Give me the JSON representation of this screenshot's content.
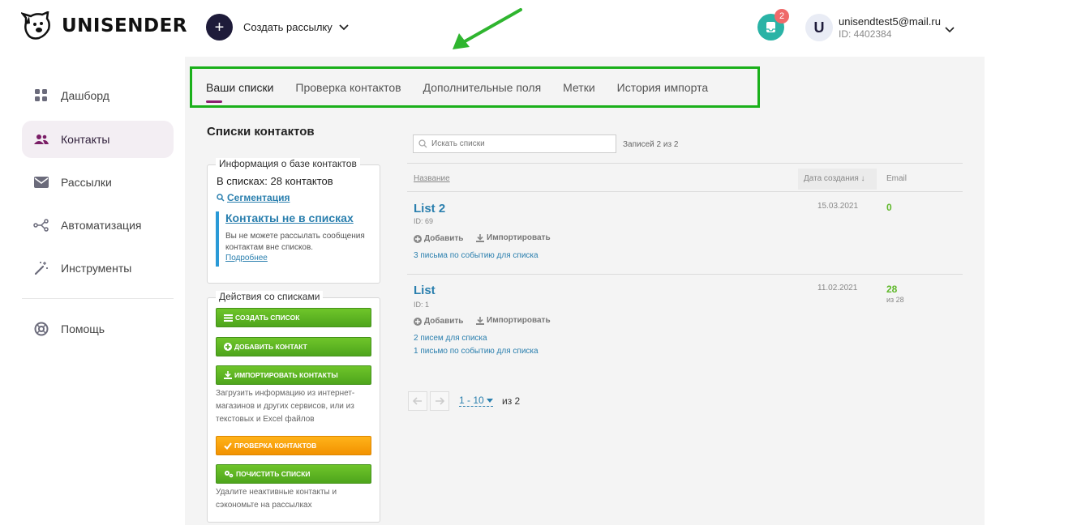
{
  "brand": {
    "name": "UNISENDER"
  },
  "header": {
    "create_label": "Создать рассылку",
    "notifications_count": "2",
    "user_initial": "U",
    "user_email": "unisendtest5@mail.ru",
    "user_id": "ID: 4402384"
  },
  "sidebar": {
    "items": [
      {
        "label": "Дашборд",
        "icon": "dashboard-icon"
      },
      {
        "label": "Контакты",
        "icon": "contacts-icon",
        "active": true
      },
      {
        "label": "Рассылки",
        "icon": "mail-icon"
      },
      {
        "label": "Автоматизация",
        "icon": "automation-icon"
      },
      {
        "label": "Инструменты",
        "icon": "magic-wand-icon"
      },
      {
        "label": "Помощь",
        "icon": "help-icon"
      }
    ]
  },
  "tabs": [
    {
      "label": "Ваши списки",
      "active": true
    },
    {
      "label": "Проверка контактов"
    },
    {
      "label": "Дополнительные поля"
    },
    {
      "label": "Метки"
    },
    {
      "label": "История импорта"
    }
  ],
  "page_title": "Списки контактов",
  "info_card": {
    "legend": "Информация о базе контактов",
    "count_text": "В списках: 28 контактов",
    "segmentation": "Сегментация",
    "not_in_lists_title": "Контакты не в списках",
    "not_in_lists_text": "Вы не можете рассылать сообщения контактам вне списков.",
    "more": "Подробнее"
  },
  "actions_card": {
    "legend": "Действия со списками",
    "create_list": "Создать список",
    "add_contact": "Добавить контакт",
    "import_contacts": "Импортировать контакты",
    "import_note": "Загрузить информацию из интернет-магазинов и других сервисов, или из текстовых и Excel файлов",
    "check_contacts": "Проверка контактов",
    "clean_lists": "Почистить списки",
    "clean_note": "Удалите неактивные контакты и сэкономьте на рассылках"
  },
  "search": {
    "placeholder": "Искать списки"
  },
  "records": "Записей 2 из 2",
  "table": {
    "col_name": "Название",
    "col_date": "Дата создания ↓",
    "col_email": "Email",
    "add_label": "Добавить",
    "import_label": "Импортировать",
    "rows": [
      {
        "name": "List 2",
        "id": "ID: 69",
        "date": "15.03.2021",
        "email": "0",
        "email_sub": "",
        "links": [
          "3 письма по событию для списка"
        ]
      },
      {
        "name": "List",
        "id": "ID: 1",
        "date": "11.02.2021",
        "email": "28",
        "email_sub": "из 28",
        "links": [
          "2 писем для списка",
          "1 письмо по событию для списка"
        ]
      }
    ]
  },
  "pagination": {
    "range": "1 - 10",
    "total": "из 2"
  },
  "colors": {
    "accent": "#8a1f6e",
    "highlight_box": "#1ab01a",
    "link": "#2a7fae",
    "green_button": "#5db523",
    "orange_button": "#f5a000"
  }
}
